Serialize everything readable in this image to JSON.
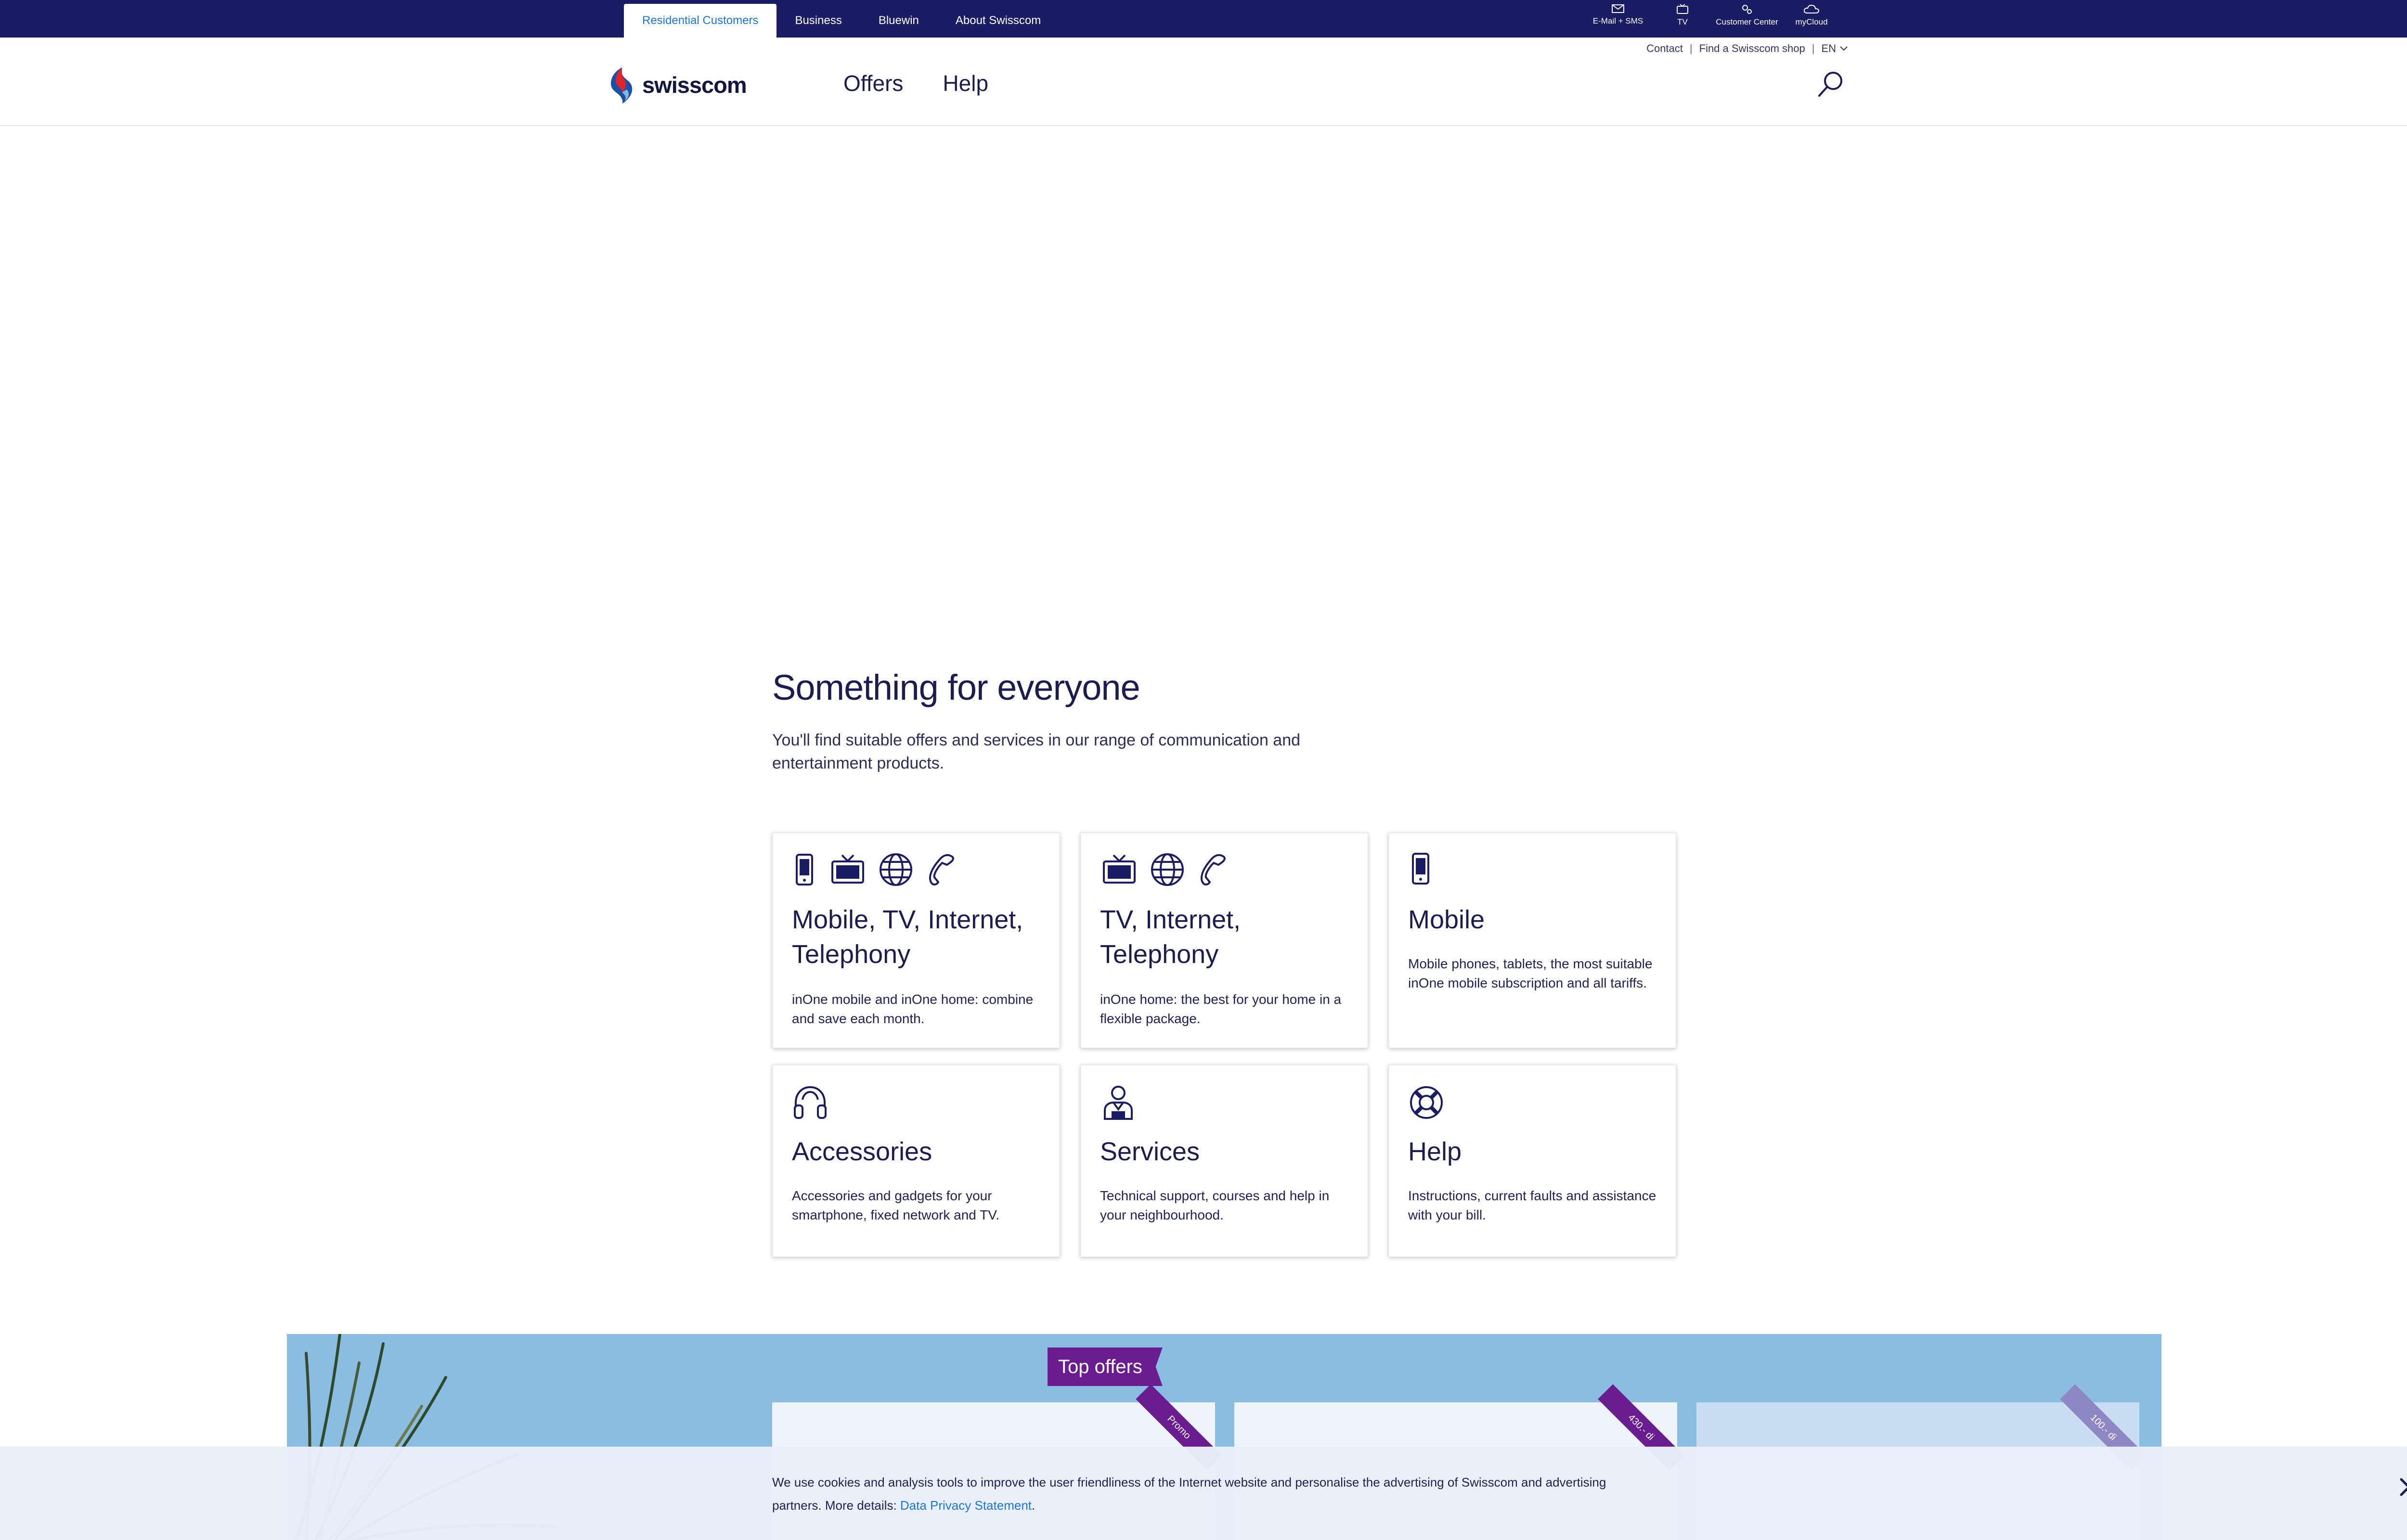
{
  "topbar": {
    "tabs": [
      "Residential Customers",
      "Business",
      "Bluewin",
      "About Swisscom"
    ],
    "links": [
      {
        "label": "E-Mail + SMS",
        "icon": "mail-icon"
      },
      {
        "label": "TV",
        "icon": "tv-icon"
      },
      {
        "label": "Customer Center",
        "icon": "gears-icon"
      },
      {
        "label": "myCloud",
        "icon": "cloud-icon"
      }
    ]
  },
  "header": {
    "utility": {
      "contact": "Contact",
      "shop": "Find a Swisscom shop",
      "language": "EN"
    },
    "logo_text": "swisscom",
    "nav": [
      "Offers",
      "Help"
    ]
  },
  "intro": {
    "title": "Something for everyone",
    "text": "You'll find suitable offers and services in our range of communication and entertainment products."
  },
  "categories": [
    {
      "title": "Mobile, TV, Internet, Telephony",
      "desc": "inOne mobile and inOne home: combine and save each month.",
      "icons": [
        "mobile-icon",
        "tv-icon",
        "globe-icon",
        "phone-icon"
      ]
    },
    {
      "title": "TV, Internet, Telephony",
      "desc": "inOne home: the best for your home in a flexible package.",
      "icons": [
        "tv-icon",
        "globe-icon",
        "phone-icon"
      ]
    },
    {
      "title": "Mobile",
      "desc": "Mobile phones, tablets, the most suitable inOne mobile subscription and all tariffs.",
      "icons": [
        "mobile-icon"
      ]
    },
    {
      "title": "Accessories",
      "desc": "Accessories and gadgets for your smartphone, fixed network and TV.",
      "icons": [
        "headphones-icon"
      ]
    },
    {
      "title": "Services",
      "desc": "Technical support, courses and help in your neighbourhood.",
      "icons": [
        "technician-icon"
      ]
    },
    {
      "title": "Help",
      "desc": "Instructions, current faults and assistance with your bill.",
      "icons": [
        "lifebuoy-icon"
      ]
    }
  ],
  "offers": {
    "label": "Top offers",
    "ribbons": [
      "Promo",
      "430.- di",
      "100.- di"
    ]
  },
  "cookie": {
    "text": "We use cookies and analysis tools to improve the user friendliness of the Internet website and personalise the advertising of Swisscom and advertising partners. More details: ",
    "link": "Data Privacy Statement",
    "end": "."
  },
  "colors": {
    "navy": "#1b1d64",
    "accent": "#1d75d8",
    "promo": "#6a1d8e",
    "offers_bg": "#8bbde2"
  }
}
